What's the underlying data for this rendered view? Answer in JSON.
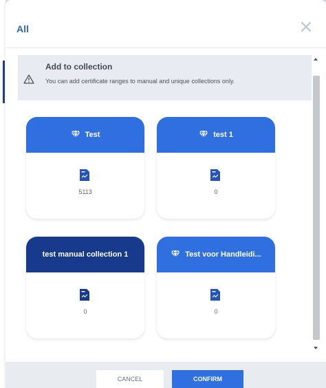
{
  "dialog": {
    "title": "All",
    "close_icon": "close-icon"
  },
  "notice": {
    "icon": "warning-icon",
    "title": "Add to collection",
    "text": "You can add certificate ranges to manual and unique collections only."
  },
  "collections": [
    {
      "name": "Test",
      "icon": "diamond-icon",
      "count": "5113",
      "style": "blue"
    },
    {
      "name": "test 1",
      "icon": "diamond-icon",
      "count": "0",
      "style": "blue"
    },
    {
      "name": "test manual collection 1",
      "icon": "",
      "count": "0",
      "style": "navy"
    },
    {
      "name": "Test voor Handleidi...",
      "icon": "diamond-icon",
      "count": "0",
      "style": "blue"
    }
  ],
  "footer": {
    "cancel_label": "CANCEL",
    "confirm_label": "CONFIRM"
  },
  "colors": {
    "accent": "#2f6fe0",
    "manual_collection": "#173a8c",
    "title": "#2f66d3"
  }
}
